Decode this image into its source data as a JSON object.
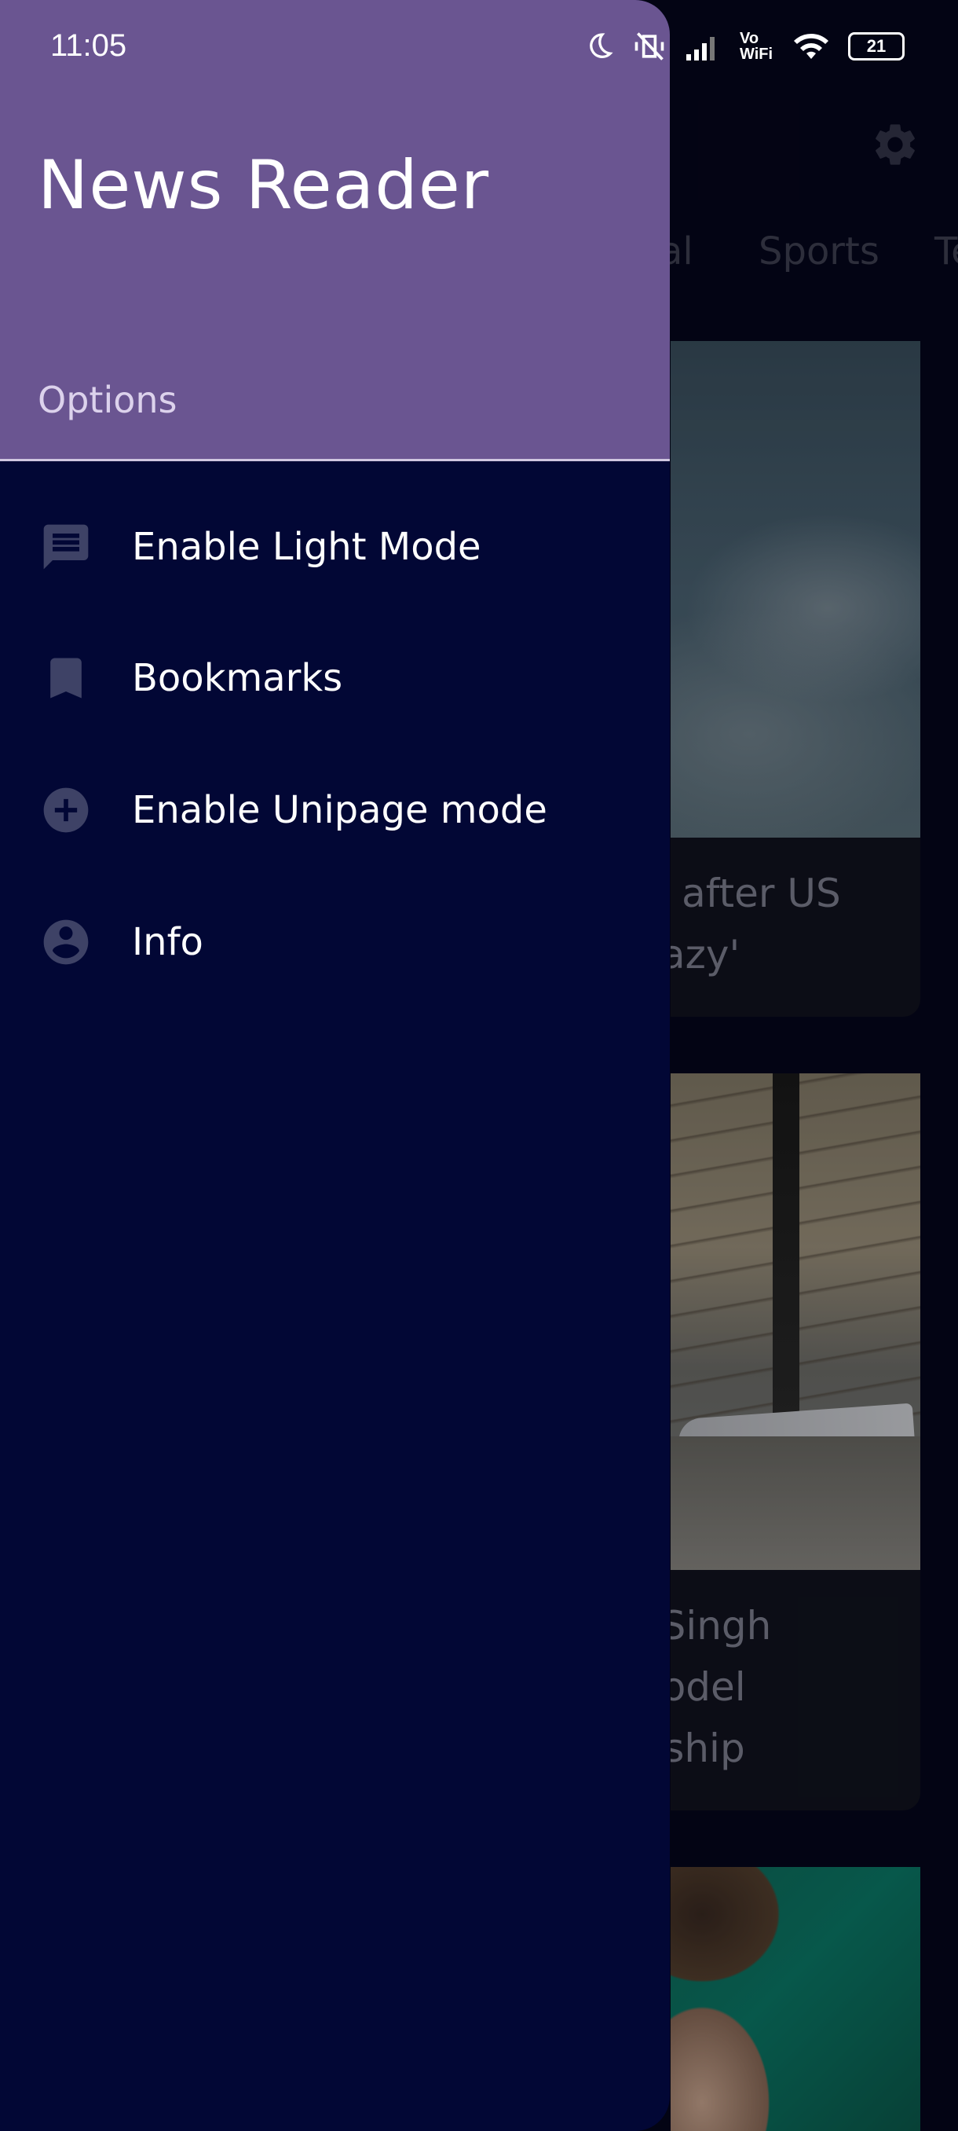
{
  "status_bar": {
    "time": "11:05",
    "battery": "21",
    "network_label": "Vo WiFi"
  },
  "drawer": {
    "title": "News Reader",
    "subtitle": "Options",
    "items": [
      {
        "label": "Enable Light Mode",
        "icon": "message-icon"
      },
      {
        "label": "Bookmarks",
        "icon": "bookmark-icon"
      },
      {
        "label": "Enable Unipage mode",
        "icon": "add-circle-icon"
      },
      {
        "label": "Info",
        "icon": "account-circle-icon"
      }
    ]
  },
  "background": {
    "tabs": [
      "al",
      "Sports",
      "Te"
    ],
    "cards": [
      {
        "title_lines": [
          "al' after US",
          "crazy'"
        ]
      },
      {
        "title_lines": [
          "n Singh",
          " model",
          "ership"
        ]
      }
    ]
  },
  "colors": {
    "drawer_header": "#6a5591",
    "drawer_body": "#020735",
    "background": "#05061c"
  }
}
